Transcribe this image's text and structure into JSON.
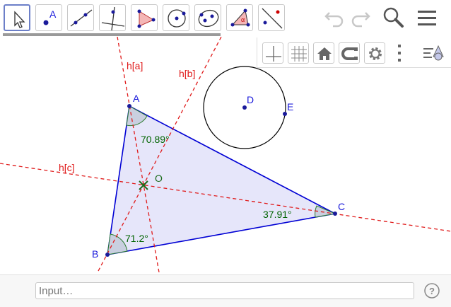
{
  "toolbar": {
    "tools": [
      {
        "icon": "move-arrow-icon",
        "selected": true
      },
      {
        "icon": "point-icon",
        "label": "A"
      },
      {
        "icon": "line-icon"
      },
      {
        "icon": "perpendicular-line-icon"
      },
      {
        "icon": "polygon-icon"
      },
      {
        "icon": "circle-center-point-icon"
      },
      {
        "icon": "ellipse-icon"
      },
      {
        "icon": "angle-icon",
        "label": "α"
      },
      {
        "icon": "reflect-about-line-icon"
      }
    ],
    "right_icons": [
      "undo-icon",
      "redo-icon",
      "search-icon",
      "menu-icon"
    ]
  },
  "stylebar": {
    "buttons": [
      "axes-icon",
      "grid-icon",
      "home-icon",
      "point-capturing-icon",
      "settings-icon",
      "more-vertical-icon",
      "toggle-style-bar-icon"
    ]
  },
  "graphics": {
    "point_labels": {
      "A": "A",
      "B": "B",
      "C": "C",
      "D": "D",
      "E": "E",
      "O": "O"
    },
    "line_labels": {
      "ha": "h[a]",
      "hb": "h[b]",
      "hc": "h[c]"
    },
    "angles": {
      "A": "70.89°",
      "B": "71.2°",
      "C": "37.91°"
    }
  },
  "input": {
    "placeholder": "Input…"
  },
  "colors": {
    "triangle": "#0000d4",
    "fill": "#e6e6fa",
    "dashed": "#e01b1b",
    "angle_text": "#006400",
    "point": "#1a1a9a",
    "label": "#1a1adb"
  }
}
